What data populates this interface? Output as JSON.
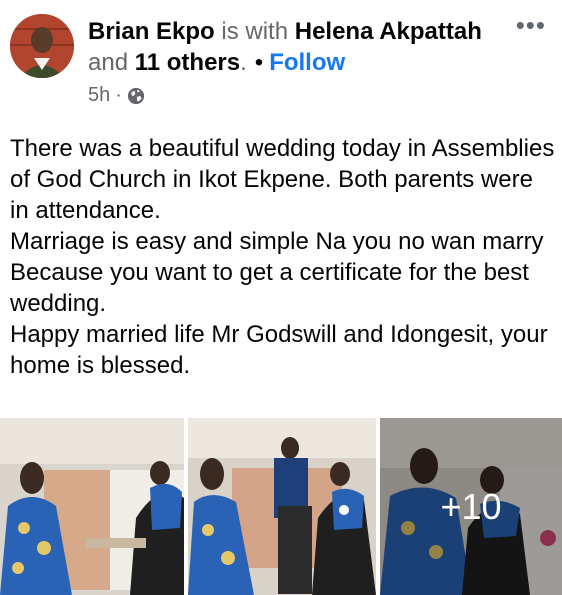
{
  "post": {
    "author": "Brian Ekpo",
    "with_text": "is with",
    "tagged_person": "Helena Akpattah",
    "and_text": "and",
    "others": "11 others",
    "period": ".",
    "separator": "•",
    "follow_label": "Follow",
    "time": "5h",
    "meta_separator": "·",
    "privacy_icon": "globe-icon",
    "more_icon": "more-options-icon",
    "more_glyph": "•••",
    "paragraphs": [
      "There was a beautiful wedding today in Assemblies of God Church in Ikot Ekpene. Both parents were in attendance.",
      "Marriage is easy and simple Na you no wan marry Because you want to get a certificate for the best wedding.",
      "Happy married life Mr Godswill and Idongesit, your home is blessed."
    ],
    "more_photos_label": "+10"
  },
  "colors": {
    "link": "#1877f2",
    "secondary_text": "#65676b",
    "avatar_bg": "#b2452e"
  }
}
